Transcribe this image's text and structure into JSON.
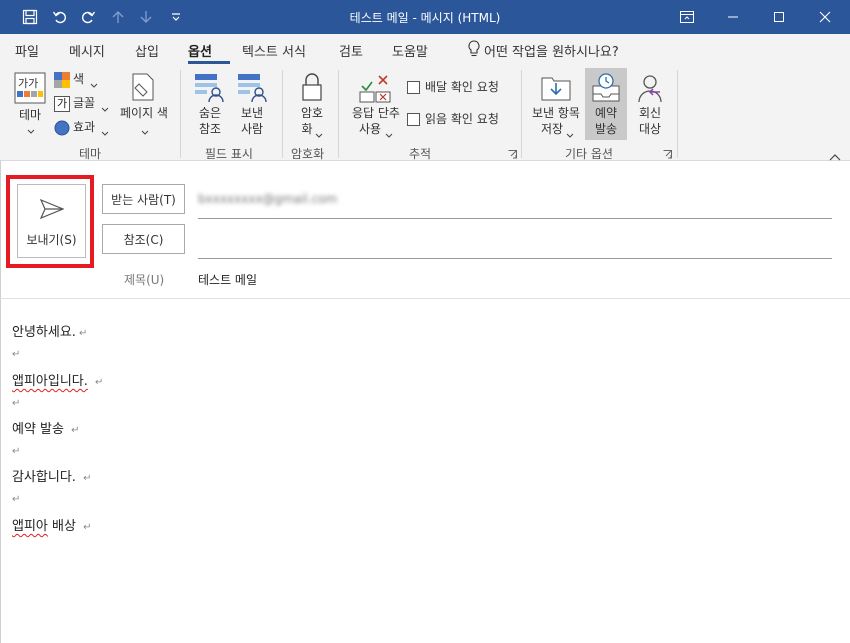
{
  "window": {
    "title": "테스트 메일  -  메시지 (HTML)"
  },
  "colors": {
    "titlebar": "#2b579a",
    "highlight_frame": "#e51a22"
  },
  "tabs": [
    "파일",
    "메시지",
    "삽입",
    "옵션",
    "텍스트 서식",
    "검토",
    "도움말"
  ],
  "active_tab": "옵션",
  "tell_me": "어떤 작업을 원하시나요?",
  "ribbon": {
    "theme": {
      "theme_label": "테마",
      "colors_label": "색",
      "fonts_label": "글꼴",
      "effects_label": "효과",
      "page_color_label": "페이지 색",
      "group": "테마"
    },
    "show_fields": {
      "bcc_label1": "숨은",
      "bcc_label2": "참조",
      "from_label1": "보낸",
      "from_label2": "사람",
      "group": "필드 표시"
    },
    "encrypt": {
      "label1": "암호",
      "label2": "화",
      "group": "암호화"
    },
    "tracking": {
      "voting_label1": "응답 단추",
      "voting_label2": "사용",
      "delivery": "배달 확인 요청",
      "read": "읽음 확인 요청",
      "group": "추적"
    },
    "more_options": {
      "save_sent_label1": "보낸 항목",
      "save_sent_label2": "저장",
      "delay_label1": "예약",
      "delay_label2": "발송",
      "reply_label1": "회신",
      "reply_label2": "대상",
      "group": "기타 옵션"
    }
  },
  "compose": {
    "send_label": "보내기(S)",
    "to_label": "받는 사람(T)",
    "to_value": "bxxxxxxxx@gmail.com",
    "cc_label": "참조(C)",
    "subject_label": "제목(U)",
    "subject_value": "테스트 메일"
  },
  "body": {
    "l1": "안녕하세요.",
    "l2": "앱피아입니다.",
    "l3": "예약 발송",
    "l4": "감사합니다.",
    "l5a": "앱피아",
    "l5b": " 배상",
    "para_mark": "↵"
  }
}
